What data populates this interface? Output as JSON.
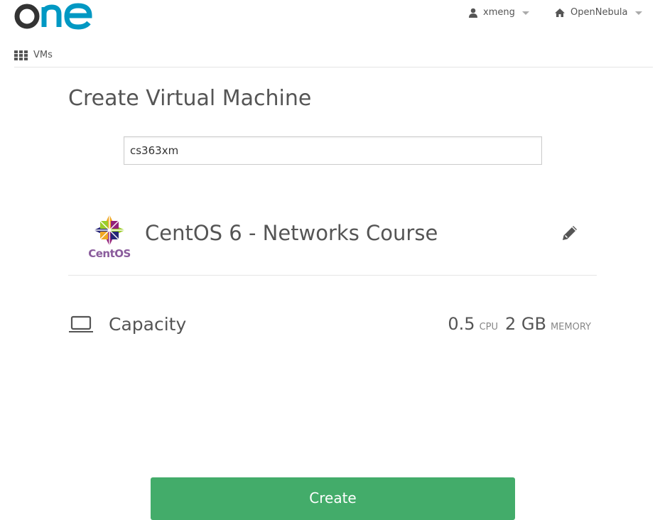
{
  "header": {
    "logo_icon": "opennebula-one-logo",
    "user": {
      "name": "xmeng",
      "icon": "user-icon"
    },
    "zone": {
      "name": "OpenNebula",
      "icon": "home-icon"
    }
  },
  "nav": {
    "vms_label": "VMs",
    "vms_icon": "grid-icon"
  },
  "page": {
    "title": "Create Virtual Machine",
    "vm_name_value": "cs363xm"
  },
  "template": {
    "logo_icon": "centos-logo",
    "logo_text": "CentOS",
    "name": "CentOS 6 - Networks Course",
    "edit_icon": "pencil-icon"
  },
  "capacity": {
    "icon": "laptop-icon",
    "label": "Capacity",
    "cpu_value": "0.5",
    "cpu_unit": "CPU",
    "memory_value": "2 GB",
    "memory_unit": "MEMORY"
  },
  "actions": {
    "create_label": "Create"
  },
  "colors": {
    "accent_blue": "#0098c3",
    "logo_dark": "#333333",
    "create_button": "#43ac6a",
    "text": "#555555"
  }
}
